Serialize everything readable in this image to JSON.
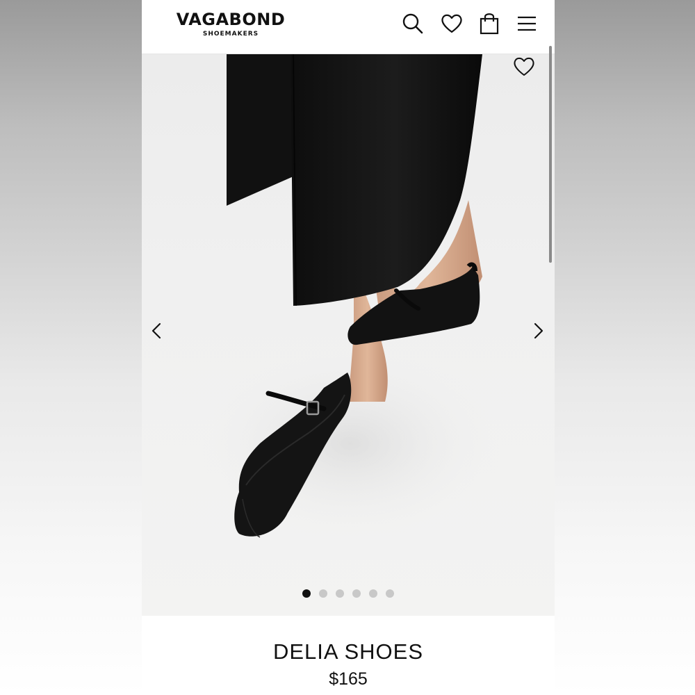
{
  "header": {
    "brand": "VAGABOND",
    "brand_sub": "SHOEMAKERS",
    "icons": [
      "search-icon",
      "heart-icon",
      "shopping-bag-icon",
      "menu-icon"
    ]
  },
  "gallery": {
    "image": "product photo of black leather mary jane flat shoes worn with a black skirt",
    "icons": [
      "heart-icon",
      "chevron-left-icon",
      "chevron-right-icon"
    ],
    "slide_count": 6,
    "active_slide": 1
  },
  "product": {
    "name": "DELIA SHOES",
    "price": "$165"
  }
}
